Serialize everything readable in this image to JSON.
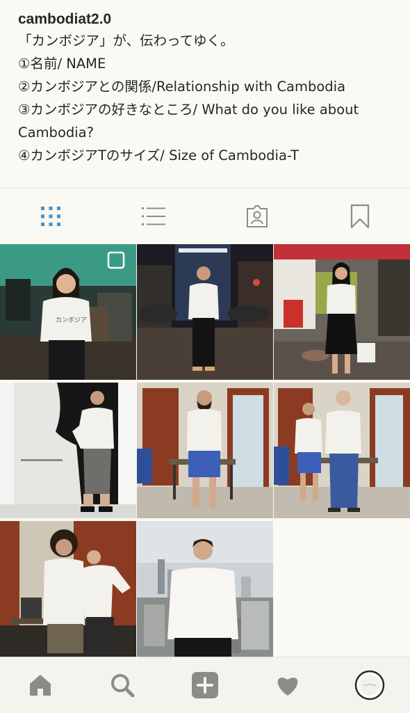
{
  "profile": {
    "username": "cambodiat2.0",
    "bio_lines": [
      "「カンボジア」が、伝わってゆく。",
      "①名前/ NAME",
      "②カンボジアとの関係/Relationship with Cambodia",
      "③カンボジアの好きなところ/ What do you like about Cambodia?",
      "④カンボジアTのサイズ/ Size of Cambodia-T"
    ]
  },
  "tabs": [
    {
      "name": "grid-view",
      "icon": "grid-icon",
      "active": true
    },
    {
      "name": "list-view",
      "icon": "list-icon",
      "active": false
    },
    {
      "name": "tagged",
      "icon": "tagged-person-icon",
      "active": false
    },
    {
      "name": "saved",
      "icon": "bookmark-icon",
      "active": false
    }
  ],
  "photos": [
    {
      "id": "photo-1",
      "scene": "cafe-woman-standing",
      "has_multi_badge": true
    },
    {
      "id": "photo-2",
      "scene": "night-street-man"
    },
    {
      "id": "photo-3",
      "scene": "market-stall-woman"
    },
    {
      "id": "photo-4",
      "scene": "wall-silhouette-man"
    },
    {
      "id": "photo-5",
      "scene": "room-man-blue-shorts"
    },
    {
      "id": "photo-6",
      "scene": "room-two-men"
    },
    {
      "id": "photo-7",
      "scene": "two-men-posing"
    },
    {
      "id": "photo-8",
      "scene": "city-skyline-man"
    }
  ],
  "shirt_print": "カンボジア",
  "bottom_nav": [
    {
      "name": "home",
      "icon": "home-icon"
    },
    {
      "name": "search",
      "icon": "search-icon"
    },
    {
      "name": "add-post",
      "icon": "add-post-icon"
    },
    {
      "name": "activity",
      "icon": "heart-icon"
    },
    {
      "name": "profile",
      "icon": "profile-avatar-icon"
    }
  ],
  "colors": {
    "accent": "#4a90c8",
    "icon_gray": "#8c8c86",
    "background": "#faf9f4"
  }
}
